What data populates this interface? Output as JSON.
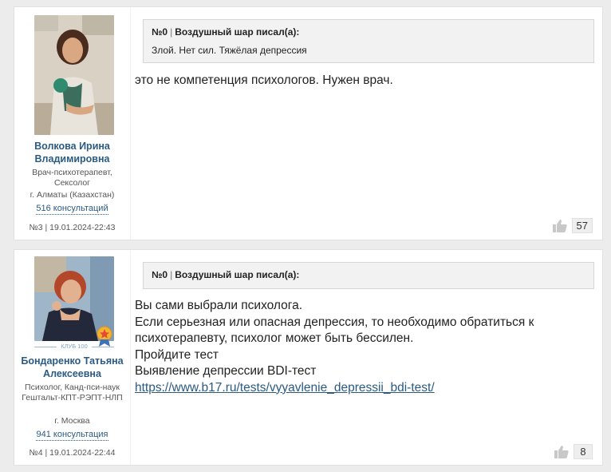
{
  "posts": [
    {
      "author": {
        "name": "Волкова Ирина Владимировна",
        "role": "Врач-психотерапевт, Сексолог",
        "city": "г. Алматы (Казахстан)",
        "consultations": "516 консультаций"
      },
      "meta": "№3 | 19.01.2024-22:43",
      "quote": {
        "number": "№0",
        "author_label": "Воздушный шар писал(а):",
        "text": "Злой. Нет сил. Тяжёлая депрессия"
      },
      "body": [
        "это не компетенция психологов. Нужен врач."
      ],
      "likes": "57"
    },
    {
      "author": {
        "name": "Бондаренко Татьяна Алексеевна",
        "role": "Психолог, Канд-пси-наук Гештальт-КПТ-РЭПТ-НЛП",
        "city": "г. Москва",
        "consultations": "941 консультация",
        "badge": "КЛУБ 100"
      },
      "meta": "№4 | 19.01.2024-22:44",
      "quote": {
        "number": "№0",
        "author_label": "Воздушный шар писал(а):",
        "text": ""
      },
      "body": [
        "Вы сами выбрали психолога.",
        "Если серьезная или опасная депрессия, то необходимо обратиться к психотерапевту, психолог может быть бессилен.",
        "Пройдите тест",
        "Выявление депрессии BDI-тест"
      ],
      "link": "https://www.b17.ru/tests/vyyavlenie_depressii_bdi-test/",
      "likes": "8"
    }
  ],
  "colors": {
    "author_link": "#2b5a83",
    "quote_bg": "#f2f2f2",
    "page_bg": "#ececec"
  },
  "icons": [
    "thumbs-up-icon",
    "club-medal-icon"
  ]
}
